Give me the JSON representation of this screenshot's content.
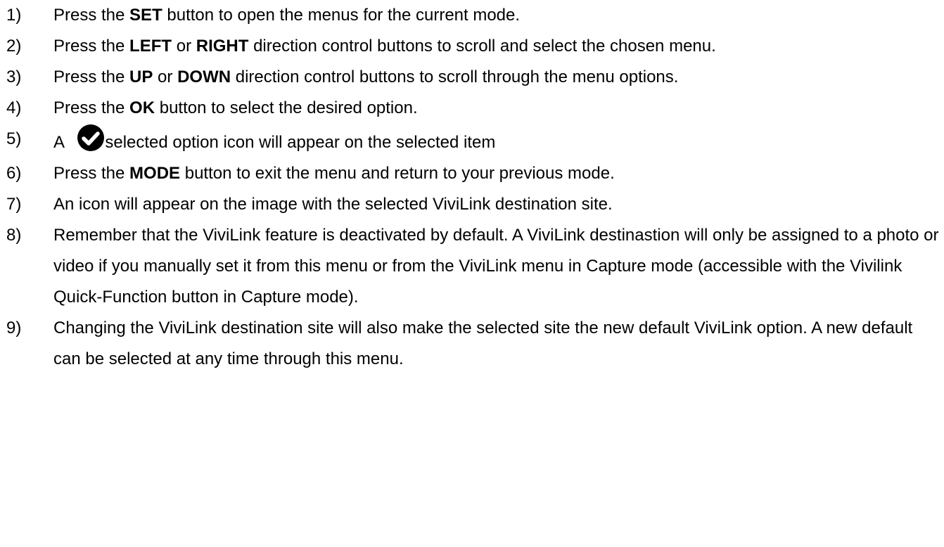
{
  "steps": [
    {
      "num": "1)",
      "parts": [
        {
          "t": "Press the "
        },
        {
          "t": "SET",
          "b": true
        },
        {
          "t": " button to open the menus for the current mode."
        }
      ]
    },
    {
      "num": "2)",
      "parts": [
        {
          "t": "Press the "
        },
        {
          "t": "LEFT",
          "b": true
        },
        {
          "t": " or "
        },
        {
          "t": "RIGHT",
          "b": true
        },
        {
          "t": " direction control buttons to scroll and select the chosen menu."
        }
      ]
    },
    {
      "num": "3)",
      "parts": [
        {
          "t": "Press the "
        },
        {
          "t": "UP",
          "b": true
        },
        {
          "t": " or "
        },
        {
          "t": "DOWN",
          "b": true
        },
        {
          "t": " direction control buttons to scroll through the menu options."
        }
      ]
    },
    {
      "num": "4)",
      "parts": [
        {
          "t": "Press the "
        },
        {
          "t": "OK",
          "b": true
        },
        {
          "t": " button to select the desired option."
        }
      ]
    },
    {
      "num": "5)",
      "parts": [
        {
          "t": "A "
        },
        {
          "icon": "check-circle-icon"
        },
        {
          "t": "selected option icon will appear on the selected item"
        }
      ]
    },
    {
      "num": "6)",
      "parts": [
        {
          "t": "Press the "
        },
        {
          "t": "MODE",
          "b": true
        },
        {
          "t": " button to exit the menu and return to your previous mode."
        }
      ]
    },
    {
      "num": "7)",
      "parts": [
        {
          "t": "An icon will appear on the image with the selected ViviLink destination site."
        }
      ]
    },
    {
      "num": "8)",
      "parts": [
        {
          "t": "Remember that the ViviLink feature is deactivated by default. A ViviLink destinastion will only be assigned to a photo or video if you manually set it from this menu or from the ViviLink menu in Capture mode (accessible with the Vivilink Quick-Function button in Capture mode)."
        }
      ]
    },
    {
      "num": "9)",
      "parts": [
        {
          "t": "Changing the ViviLink destination site will also make the selected site the new default ViviLink option. A new default can be selected at any time through this menu."
        }
      ]
    }
  ],
  "colors": {
    "text": "#000000",
    "icon": "#000000"
  }
}
